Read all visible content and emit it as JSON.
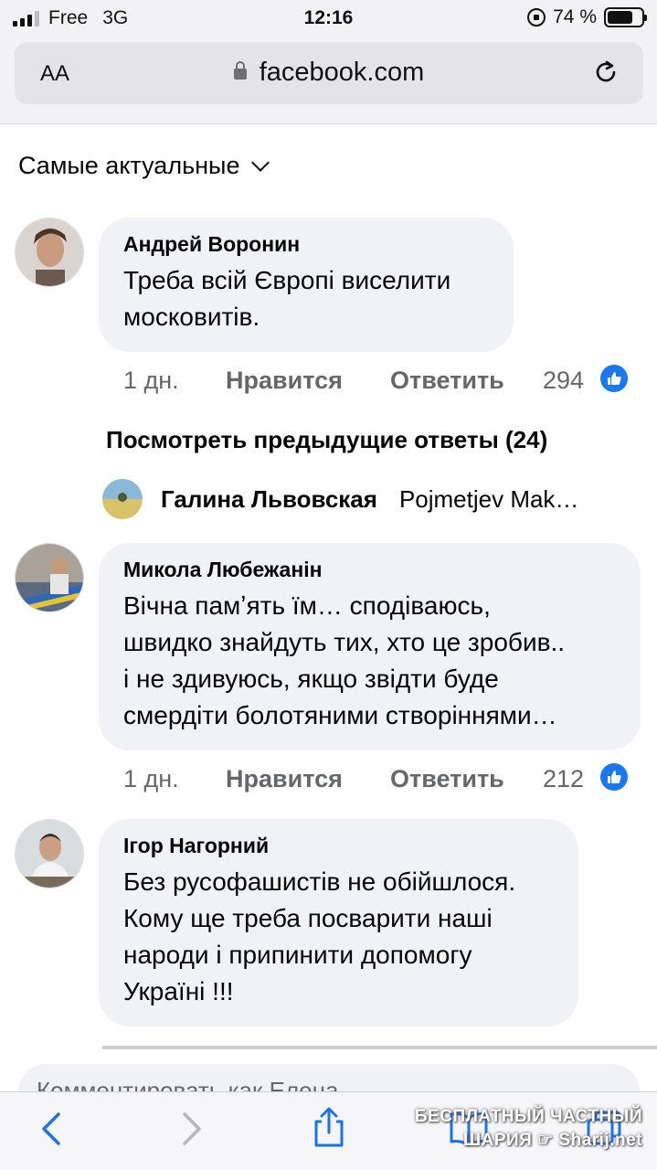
{
  "status_bar": {
    "carrier": "Free",
    "network": "3G",
    "time": "12:16",
    "battery": "74 %",
    "battery_level": 0.74
  },
  "browser": {
    "text_size_label": "AA",
    "url": "facebook.com"
  },
  "sort": {
    "label": "Самые актуальные"
  },
  "comments": [
    {
      "author": "Андрей Воронин",
      "text": [
        "Треба всій Європі виселити",
        "московитів."
      ],
      "time": "1 дн.",
      "like_label": "Нравится",
      "reply_label": "Ответить",
      "likes": "294"
    },
    {
      "author": "Микола Любежанін",
      "text": [
        "Вічна памʼять їм… сподіваюсь,",
        "швидко знайдуть тих, хто це зробив..",
        "і не здивуюсь, якщо звідти буде",
        "смердіти болотяними створіннями…"
      ],
      "time": "1 дн.",
      "like_label": "Нравится",
      "reply_label": "Ответить",
      "likes": "212"
    },
    {
      "author": "Ігор Нагорний",
      "text": [
        "Без русофашистів не обійшлося.",
        "Кому ще треба посварити наші",
        "народи і припинити допомогу",
        "Україні !!!"
      ]
    }
  ],
  "previous_replies": {
    "label": "Посмотреть предыдущие ответы (24)"
  },
  "reply_preview": {
    "author": "Галина Львовская",
    "text": "Pojmetjev Mak…"
  },
  "composer": {
    "placeholder": "Комментировать как Елена"
  },
  "watermark": {
    "line1": "БЕСПЛАТНЫЙ ЧАСТНЫЙ",
    "line2": "ШАРИЯ ☞ Sharij.net"
  },
  "icons": {
    "like": "thumbs-up-icon",
    "back": "chevron-left-icon",
    "forward": "chevron-right-icon",
    "share": "share-icon",
    "bookmarks": "book-icon",
    "tabs": "tabs-icon"
  },
  "colors": {
    "like_blue": "#1877f2",
    "bubble": "#f0f2f5",
    "meta": "#65676b"
  }
}
